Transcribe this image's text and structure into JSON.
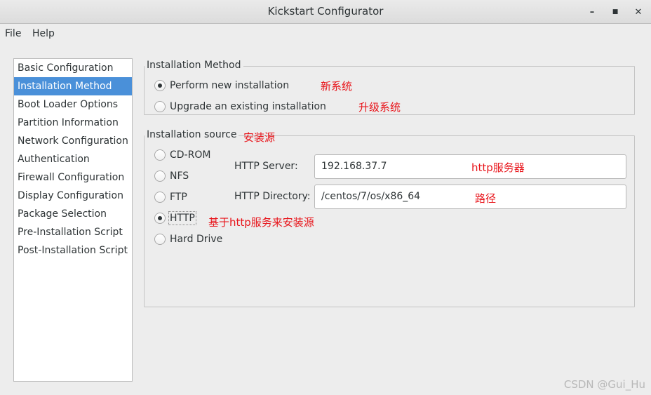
{
  "window": {
    "title": "Kickstart Configurator",
    "minimize_glyph": "–",
    "maximize_glyph": "■",
    "close_glyph": "✕"
  },
  "menu": [
    "File",
    "Help"
  ],
  "sidebar": {
    "items": [
      {
        "label": "Basic Configuration"
      },
      {
        "label": "Installation Method"
      },
      {
        "label": "Boot Loader Options"
      },
      {
        "label": "Partition Information"
      },
      {
        "label": "Network Configuration"
      },
      {
        "label": "Authentication"
      },
      {
        "label": "Firewall Configuration"
      },
      {
        "label": "Display Configuration"
      },
      {
        "label": "Package Selection"
      },
      {
        "label": "Pre-Installation Script"
      },
      {
        "label": "Post-Installation Script"
      }
    ],
    "selected": "Installation Method"
  },
  "installation_method": {
    "title": "Installation Method",
    "options": [
      {
        "label": "Perform new installation",
        "selected": true
      },
      {
        "label": "Upgrade an existing installation",
        "selected": false
      }
    ]
  },
  "installation_source": {
    "title": "Installation source",
    "options": [
      {
        "label": "CD-ROM",
        "selected": false
      },
      {
        "label": "NFS",
        "selected": false
      },
      {
        "label": "FTP",
        "selected": false
      },
      {
        "label": "HTTP",
        "selected": true
      },
      {
        "label": "Hard Drive",
        "selected": false
      }
    ],
    "http_server_label": "HTTP Server:",
    "http_server_value": "192.168.37.7",
    "http_directory_label": "HTTP Directory:",
    "http_directory_value": "/centos/7/os/x86_64"
  },
  "annotations": {
    "new_system": "新系统",
    "upgrade_system": "升级系统",
    "install_source": "安装源",
    "http_server": "http服务器",
    "path": "路径",
    "http_based": "基于http服务来安装源"
  },
  "watermark": "CSDN @Gui_Hu",
  "colors": {
    "selection": "#4a90d9",
    "annotation": "#e8151b",
    "background": "#ededed"
  }
}
